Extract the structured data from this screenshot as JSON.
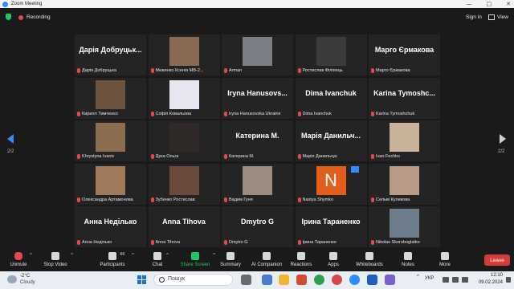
{
  "window": {
    "title": "Zoom Meeting",
    "controls": [
      "—",
      "□",
      "✕"
    ]
  },
  "topbar": {
    "recording_label": "Recording",
    "sign_in": "Sign in",
    "view_label": "View"
  },
  "pagination": {
    "left": "2/2",
    "right": "2/2"
  },
  "participants": [
    {
      "big_name": "Дарія Добруцьк...",
      "caption": "Дарія Добруцька",
      "video": false
    },
    {
      "big_name": "",
      "caption": "Меженко Ксенія МВ-2...",
      "video": true,
      "photo_color": "#8a6a52"
    },
    {
      "big_name": "",
      "caption": "Arman",
      "video": true,
      "photo_color": "#7a7f86"
    },
    {
      "big_name": "",
      "caption": "Ростислав Філіпець",
      "video": true,
      "photo_color": "#3c3a3a"
    },
    {
      "big_name": "Марго Єрмакова",
      "caption": "Марго Єрмакова",
      "video": false
    },
    {
      "big_name": "",
      "caption": "Кирилл Тимченко",
      "video": true,
      "photo_color": "#6b5340"
    },
    {
      "big_name": "",
      "caption": "Софія Ковальова",
      "video": true,
      "photo_color": "#e8e4f0"
    },
    {
      "big_name": "Iryna Hanusovs...",
      "caption": "Iryna Hanusovska Ukraine",
      "video": false
    },
    {
      "big_name": "Dima Ivanchuk",
      "caption": "Dima Ivanchuk",
      "video": false
    },
    {
      "big_name": "Karina Tymoshc...",
      "caption": "Karina Tymoshchuk",
      "video": false
    },
    {
      "big_name": "",
      "caption": "Khrystyna Ivaniv",
      "video": true,
      "photo_color": "#8c6d4f"
    },
    {
      "big_name": "",
      "caption": "Дука Ольга",
      "video": true,
      "photo_color": "#2f2a28"
    },
    {
      "big_name": "Катерина М.",
      "caption": "Катерина М.",
      "video": false
    },
    {
      "big_name": "Марія Данильч...",
      "caption": "Марія Данильчук",
      "video": false
    },
    {
      "big_name": "",
      "caption": "Ivan Fechko",
      "video": true,
      "photo_color": "#c8b29a"
    },
    {
      "big_name": "",
      "caption": "Олександра Артамонова",
      "video": true,
      "photo_color": "#a07a5a"
    },
    {
      "big_name": "",
      "caption": "Зубенко Ростислав",
      "video": true,
      "photo_color": "#6a4a3c"
    },
    {
      "big_name": "",
      "caption": "Вадим Гуня",
      "video": true,
      "photo_color": "#9a8c80"
    },
    {
      "big_name": "",
      "caption": "Nastya Shymko",
      "video": false,
      "initial": "N"
    },
    {
      "big_name": "",
      "caption": "Сельві Куликова",
      "video": true,
      "photo_color": "#b89a86"
    },
    {
      "big_name": "Анна Неділько",
      "caption": "Анна Неділько",
      "video": false
    },
    {
      "big_name": "Anna Tihova",
      "caption": "Anna Tihova",
      "video": false
    },
    {
      "big_name": "Dmytro G",
      "caption": "Dmytro G",
      "video": false
    },
    {
      "big_name": "Ірина Тараненко",
      "caption": "Ірина Тараненко",
      "video": false
    },
    {
      "big_name": "",
      "caption": "Nikolas Skoroboglatko",
      "video": true,
      "photo_color": "#6d7d8c"
    }
  ],
  "toolbar": {
    "unmute": "Unmute",
    "stop_video": "Stop Video",
    "participants": "Participants",
    "participant_count": "44",
    "chat": "Chat",
    "share_screen": "Share Screen",
    "summary": "Summary",
    "ai_companion": "AI Companion",
    "reactions": "Reactions",
    "apps": "Apps",
    "whiteboards": "Whiteboards",
    "notes": "Notes",
    "more": "More",
    "leave": "Leave"
  },
  "taskbar": {
    "temperature": "-2°C",
    "condition": "Cloudy",
    "search_placeholder": "Пошук",
    "language": "УКР",
    "time": "12:10",
    "date": "09.02.2024"
  },
  "colors": {
    "accent": "#2d8cff",
    "share_green": "#23c55e",
    "leave_red": "#d43b3b",
    "muted_red": "#e5484d"
  }
}
